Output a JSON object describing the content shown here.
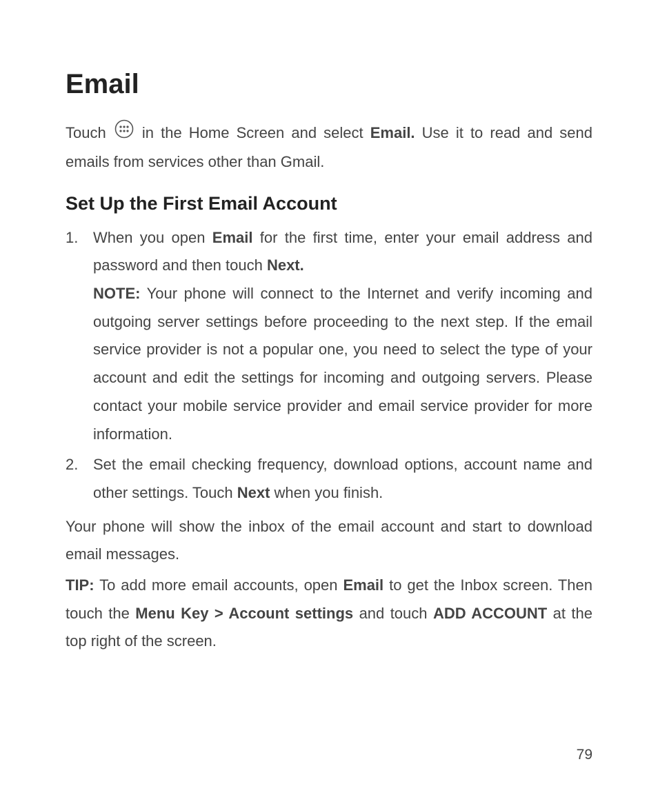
{
  "heading": "Email",
  "intro": {
    "before_icon": "Touch ",
    "after_icon_1": " in the Home Screen and select ",
    "email_bold": "Email.",
    "after_email": " Use it to read and send emails from services other than Gmail."
  },
  "subheading": "Set Up the First Email Account",
  "steps": [
    {
      "part1": "When you open ",
      "bold1": "Email",
      "part2": " for the first time, enter your email address and password and then touch ",
      "bold2": "Next.",
      "note_label": "NOTE:",
      "note_text": " Your phone will connect to the Internet and verify incoming and outgoing server settings before proceeding to the next step. If the email service provider is not a popular one, you need to select the type of your account and edit the settings for incoming and outgoing servers. Please contact your mobile service provider and email service provider for more information."
    },
    {
      "part1": "Set the email checking frequency, download options, account name and other settings. Touch ",
      "bold1": "Next",
      "part2": " when you finish."
    }
  ],
  "conclusion": "Your phone will show the inbox of the email account and start to download email messages.",
  "tip": {
    "label": "TIP:",
    "part1": " To add more email accounts, open ",
    "bold1": "Email",
    "part2": " to get the Inbox screen. Then touch the ",
    "bold2": "Menu Key > Account settings",
    "part3": " and touch ",
    "bold3": "ADD ACCOUNT",
    "part4": " at the top right of the screen."
  },
  "page_number": "79"
}
